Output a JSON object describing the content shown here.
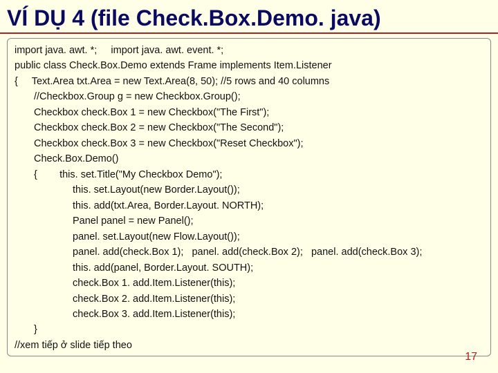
{
  "title": "VÍ DỤ 4 (file Check.Box.Demo. java)",
  "code": {
    "l0": "import java. awt. *;     import java. awt. event. *;",
    "l1": "public class Check.Box.Demo extends Frame implements Item.Listener",
    "l2": "{",
    "l2b": "Text.Area txt.Area = new Text.Area(8, 50); //5 rows and 40 columns",
    "l3": "//Checkbox.Group g = new Checkbox.Group();",
    "l4": "Checkbox check.Box 1 = new Checkbox(\"The First\");",
    "l5": "Checkbox check.Box 2 = new Checkbox(\"The Second\");",
    "l6": "Checkbox check.Box 3 = new Checkbox(\"Reset Checkbox\");",
    "l7": "Check.Box.Demo()",
    "l8": "{",
    "l8b": "this. set.Title(\"My Checkbox Demo\");",
    "l9": "this. set.Layout(new Border.Layout());",
    "l10": "this. add(txt.Area, Border.Layout. NORTH);",
    "l11": "Panel panel = new Panel();",
    "l12": "panel. set.Layout(new Flow.Layout());",
    "l13": "panel. add(check.Box 1);   panel. add(check.Box 2);   panel. add(check.Box 3);",
    "l14": "this. add(panel, Border.Layout. SOUTH);",
    "l15": "check.Box 1. add.Item.Listener(this);",
    "l16": "check.Box 2. add.Item.Listener(this);",
    "l17": "check.Box 3. add.Item.Listener(this);",
    "l18": "}",
    "l19": "//xem tiếp ở slide tiếp theo"
  },
  "page": "17"
}
